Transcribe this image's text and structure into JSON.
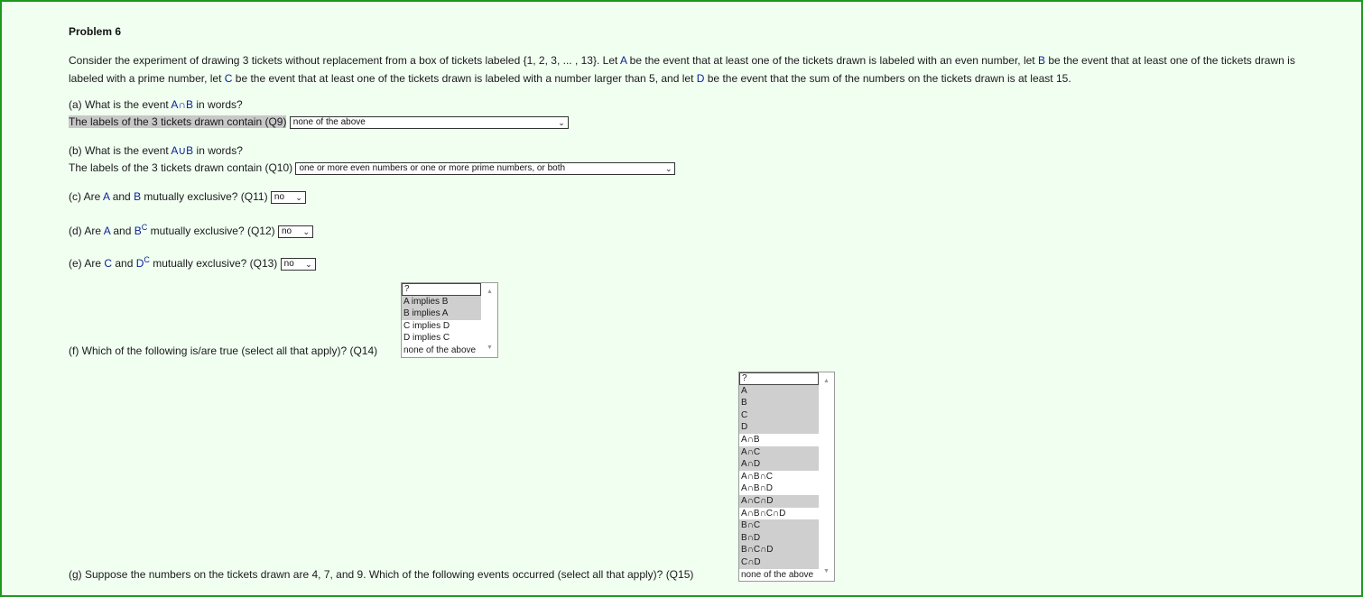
{
  "problem": {
    "title": "Problem 6",
    "intro": {
      "p1": "Consider the experiment of drawing 3 tickets without replacement from a box of tickets labeled {1, 2, 3, ... , 13}. Let ",
      "A": "A",
      "p2": " be the event that at least one of the tickets drawn is labeled with an even number, let ",
      "B": "B",
      "p3": " be the event that at least one of the tickets drawn is labeled with a prime number, let ",
      "C": "C",
      "p4": " be the event that at least one of the tickets drawn is labeled with a number larger than 5, and let ",
      "D": "D",
      "p5": " be the event that the sum of the numbers on the tickets drawn is at least 15."
    }
  },
  "qa": {
    "prefix": "(a) What is the event ",
    "event": "A∩B",
    "suffix": " in words?",
    "line2": "The labels of the 3 tickets drawn contain (Q9)",
    "select": "none of the above"
  },
  "qb": {
    "prefix": "(b) What is the event ",
    "event": "A∪B",
    "suffix": " in words?",
    "line2": "The labels of the 3 tickets drawn contain (Q10)",
    "select": "one or more even numbers or one or more prime numbers, or both"
  },
  "qc": {
    "p1": "(c) Are ",
    "e1": "A",
    "p2": " and ",
    "e2": "B",
    "p3": " mutually exclusive? (Q11)",
    "select": "no"
  },
  "qd": {
    "p1": "(d) Are ",
    "e1": "A",
    "p2": " and ",
    "e2": "B",
    "sup": "C",
    "p3": " mutually exclusive? (Q12)",
    "select": "no"
  },
  "qe": {
    "p1": "(e) Are ",
    "e1": "C",
    "p2": " and ",
    "e2": "D",
    "sup": "C",
    "p3": " mutually exclusive? (Q13)",
    "select": "no"
  },
  "qf": {
    "label": "(f) Which of the following is/are true (select all that apply)? (Q14)",
    "options": [
      {
        "label": "?",
        "selected": false
      },
      {
        "label": "A implies B",
        "selected": true
      },
      {
        "label": "B implies A",
        "selected": true
      },
      {
        "label": "C implies D",
        "selected": false
      },
      {
        "label": "D implies C",
        "selected": false
      },
      {
        "label": "none of the above",
        "selected": false
      }
    ]
  },
  "qg": {
    "label": "(g) Suppose the numbers on the tickets drawn are 4, 7, and 9. Which of the following events occurred (select all that apply)? (Q15)",
    "options": [
      {
        "label": "?",
        "selected": false
      },
      {
        "label": "A",
        "selected": true
      },
      {
        "label": "B",
        "selected": true
      },
      {
        "label": "C",
        "selected": true
      },
      {
        "label": "D",
        "selected": true
      },
      {
        "label": "A∩B",
        "selected": false
      },
      {
        "label": "A∩C",
        "selected": true
      },
      {
        "label": "A∩D",
        "selected": true
      },
      {
        "label": "A∩B∩C",
        "selected": false
      },
      {
        "label": "A∩B∩D",
        "selected": false
      },
      {
        "label": "A∩C∩D",
        "selected": true
      },
      {
        "label": "A∩B∩C∩D",
        "selected": false
      },
      {
        "label": "B∩C",
        "selected": true
      },
      {
        "label": "B∩D",
        "selected": true
      },
      {
        "label": "B∩C∩D",
        "selected": true
      },
      {
        "label": "C∩D",
        "selected": true
      },
      {
        "label": "none of the above",
        "selected": false
      }
    ]
  },
  "icons": {
    "dropdown": "chevron-down-icon",
    "scroll_up": "scroll-up-arrow-icon",
    "scroll_down": "scroll-down-arrow-icon"
  },
  "colors": {
    "background": "#f1fff1",
    "border": "#1a9a1a",
    "event_letter": "#0a1f9a",
    "selected_option": "#cfcfcf"
  }
}
